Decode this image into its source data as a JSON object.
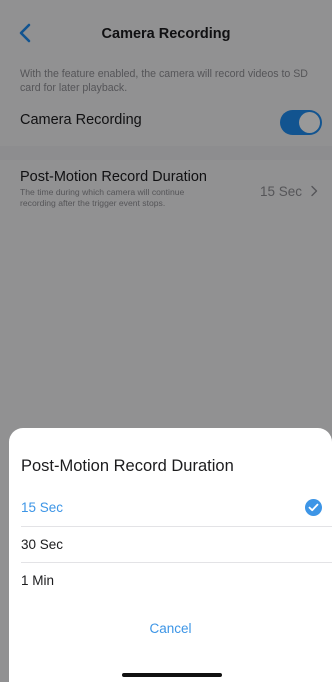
{
  "nav": {
    "back_icon": "chevron-left-icon",
    "title": "Camera Recording"
  },
  "settings": {
    "feature_description": "With the feature enabled, the camera will record videos to SD card for later playback.",
    "recording_toggle": {
      "label": "Camera Recording",
      "enabled": true
    },
    "duration_row": {
      "title": "Post-Motion Record Duration",
      "subtitle": "The time during which camera will continue recording after the trigger event stops.",
      "value": "15 Sec",
      "chevron_icon": "chevron-right-icon"
    }
  },
  "sheet": {
    "title": "Post-Motion Record Duration",
    "options": [
      {
        "label": "15 Sec",
        "selected": true
      },
      {
        "label": "30 Sec",
        "selected": false
      },
      {
        "label": "1 Min",
        "selected": false
      }
    ],
    "selected_icon": "checkmark-circle-icon",
    "cancel_label": "Cancel"
  },
  "colors": {
    "accent": "#3d95e6",
    "toggle_on": "#1e8cf0",
    "page_background": "#f2f2f4",
    "overlay": "rgba(0,0,0,0.40)"
  }
}
